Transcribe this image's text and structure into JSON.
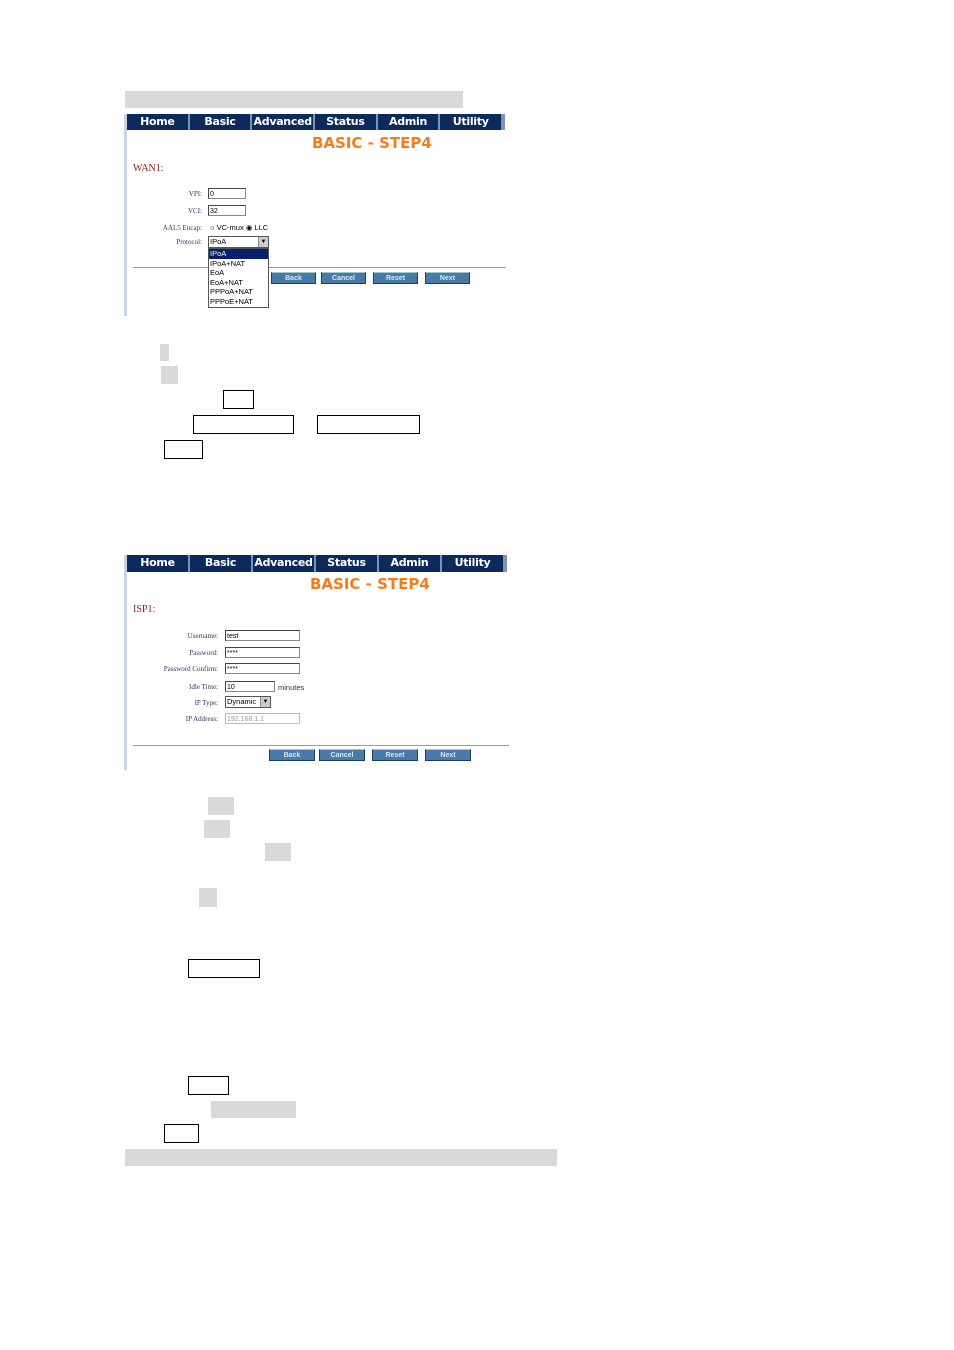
{
  "nav": [
    "Home",
    "Basic",
    "Advanced",
    "Status",
    "Admin",
    "Utility"
  ],
  "screen1": {
    "title": "BASIC - STEP4",
    "section": "WAN1:",
    "vpi_label": "VPI:",
    "vpi": "0",
    "vci_label": "VCI:",
    "vci": "32",
    "aal5_label": "AAL5 Encap:",
    "vcmux": "VC-mux",
    "llc": "LLC",
    "protocol_label": "Protocol:",
    "protocol": "IPoA",
    "protocol_options": [
      "IPoA",
      "IPoA+NAT",
      "EoA",
      "EoA+NAT",
      "PPPoA+NAT",
      "PPPoE+NAT"
    ],
    "buttons": [
      "Back",
      "Cancel",
      "Reset",
      "Next"
    ]
  },
  "screen2": {
    "title": "BASIC - STEP4",
    "section": "ISP1:",
    "username_label": "Username:",
    "username": "test",
    "password_label": "Password:",
    "password": "****",
    "confirm_label": "Password Confirm:",
    "confirm": "****",
    "idle_label": "Idle Time:",
    "idle": "10",
    "idle_unit": "minutes",
    "iptype_label": "IP Type:",
    "iptype": "Dynamic",
    "ipaddr_label": "IP Address:",
    "ipaddr": "192.168.1.1",
    "buttons": [
      "Back",
      "Cancel",
      "Reset",
      "Next"
    ]
  },
  "icons": {
    "dropdown": "chevron-down-icon",
    "radio": "radio-icon"
  }
}
